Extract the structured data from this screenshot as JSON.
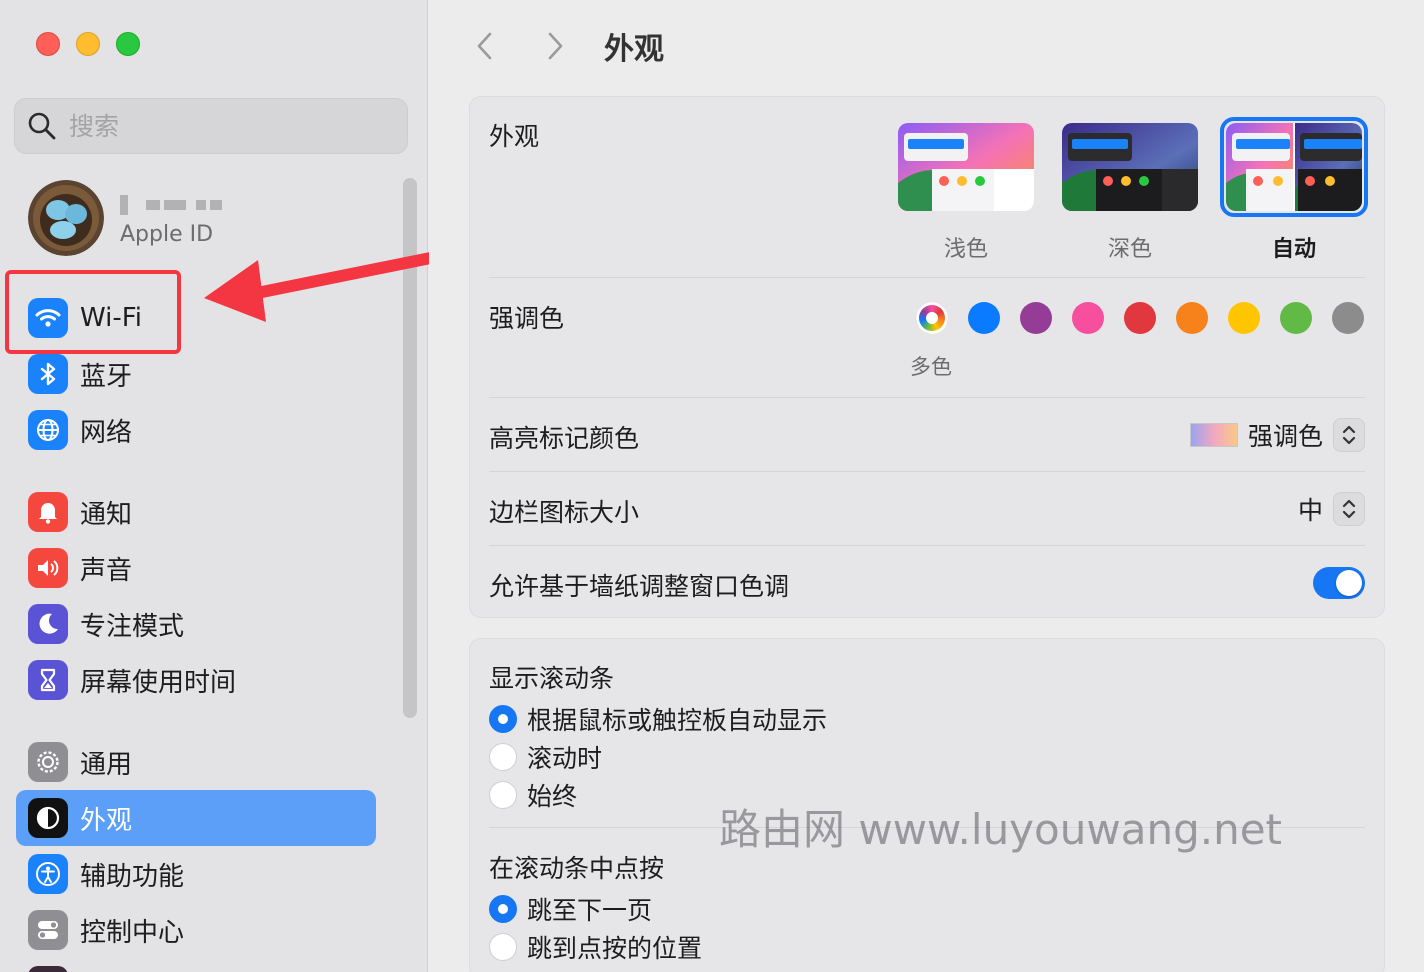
{
  "sidebar": {
    "search_placeholder": "搜索",
    "profile": {
      "subtitle": "Apple ID"
    },
    "items": [
      {
        "label": "Wi-Fi",
        "icon": "wifi-icon",
        "color": "#1a82fb"
      },
      {
        "label": "蓝牙",
        "icon": "bluetooth-icon",
        "color": "#1a82fb"
      },
      {
        "label": "网络",
        "icon": "globe-icon",
        "color": "#1a82fb"
      },
      {
        "label": "通知",
        "icon": "bell-icon",
        "color": "#f4473d"
      },
      {
        "label": "声音",
        "icon": "speaker-icon",
        "color": "#f4473d"
      },
      {
        "label": "专注模式",
        "icon": "moon-icon",
        "color": "#5b53d6"
      },
      {
        "label": "屏幕使用时间",
        "icon": "hourglass-icon",
        "color": "#5b53d6"
      },
      {
        "label": "通用",
        "icon": "gear-icon",
        "color": "#8e8e93"
      },
      {
        "label": "外观",
        "icon": "appearance-icon",
        "color": "#111111",
        "active": true
      },
      {
        "label": "辅助功能",
        "icon": "accessibility-icon",
        "color": "#1a82fb"
      },
      {
        "label": "控制中心",
        "icon": "toggles-icon",
        "color": "#8e8e93"
      }
    ]
  },
  "main": {
    "title": "外观",
    "appearance": {
      "label": "外观",
      "options": [
        {
          "label": "浅色",
          "selected": false
        },
        {
          "label": "深色",
          "selected": false
        },
        {
          "label": "自动",
          "selected": true
        }
      ]
    },
    "accent": {
      "label": "强调色",
      "selected_label": "多色",
      "colors": [
        "multicolor",
        "#0a7aff",
        "#953d96",
        "#f74f9e",
        "#e0383e",
        "#f7821b",
        "#ffc600",
        "#62ba46",
        "#8c8c8c"
      ]
    },
    "highlight": {
      "label": "高亮标记颜色",
      "value": "强调色"
    },
    "sidebar_icon_size": {
      "label": "边栏图标大小",
      "value": "中"
    },
    "wallpaper_tint": {
      "label": "允许基于墙纸调整窗口色调",
      "on": true
    },
    "scrollbars": {
      "label": "显示滚动条",
      "options": [
        {
          "label": "根据鼠标或触控板自动显示",
          "selected": true
        },
        {
          "label": "滚动时",
          "selected": false
        },
        {
          "label": "始终",
          "selected": false
        }
      ]
    },
    "click_scrollbar": {
      "label": "在滚动条中点按",
      "options": [
        {
          "label": "跳至下一页",
          "selected": true
        },
        {
          "label": "跳到点按的位置",
          "selected": false
        }
      ]
    }
  },
  "watermark": "路由网 www.luyouwang.net"
}
